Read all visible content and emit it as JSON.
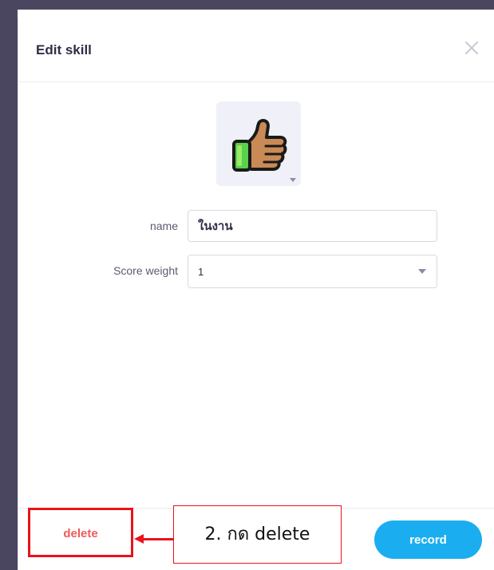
{
  "modal": {
    "title": "Edit skill",
    "close_icon": "close-icon"
  },
  "skill_icon": {
    "icon": "thumbs-up-icon",
    "colors": {
      "skin": "#c98a55",
      "cuff": "#57d24a",
      "outline": "#1a1a1a"
    }
  },
  "form": {
    "name_label": "name",
    "name_value": "ในงาน",
    "score_weight_label": "Score weight",
    "score_weight_value": "1"
  },
  "footer": {
    "delete_label": "delete",
    "record_label": "record"
  },
  "annotation": {
    "callout_text": "2. กด delete",
    "color": "#e8131b"
  },
  "colors": {
    "accent": "#1aaef0",
    "danger": "#f05a5a",
    "title": "#2e2e46"
  }
}
